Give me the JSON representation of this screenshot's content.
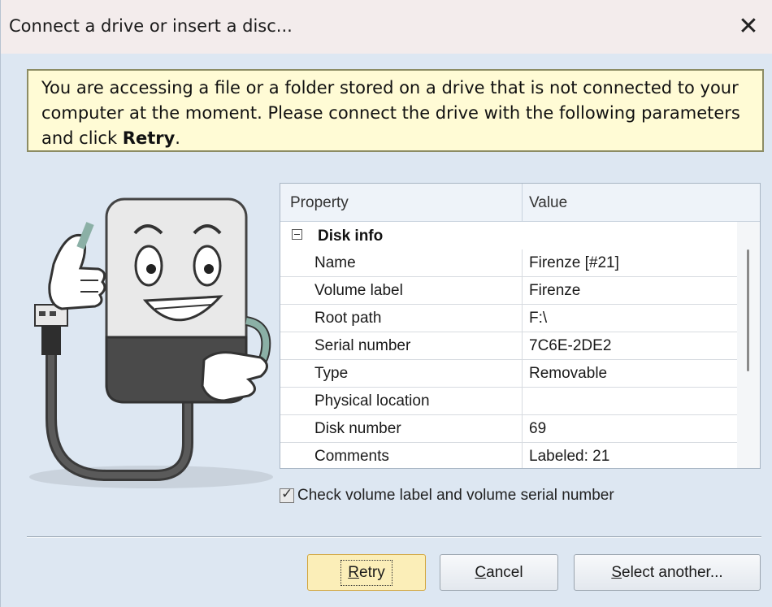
{
  "window": {
    "title": "Connect a drive or insert a disc...",
    "close_glyph": "✕"
  },
  "message": {
    "text": "You are accessing a file or a folder stored on a drive that is not connected to your computer at the moment. Please connect the drive with the following parameters and click ",
    "bold": "Retry",
    "end": "."
  },
  "grid": {
    "columns": [
      "Property",
      "Value"
    ],
    "group": {
      "label": "Disk info",
      "expander": "−"
    },
    "rows": [
      {
        "property": "Name",
        "value": "Firenze [#21]"
      },
      {
        "property": "Volume label",
        "value": "Firenze"
      },
      {
        "property": "Root path",
        "value": "F:\\"
      },
      {
        "property": "Serial number",
        "value": "7C6E-2DE2"
      },
      {
        "property": "Type",
        "value": "Removable"
      },
      {
        "property": "Physical location",
        "value": ""
      },
      {
        "property": "Disk number",
        "value": "69"
      },
      {
        "property": "Comments",
        "value": "Labeled: 21"
      }
    ]
  },
  "checkbox": {
    "label": "Check volume label and volume serial number",
    "checked": true
  },
  "buttons": {
    "retry": {
      "first": "R",
      "rest": "etry"
    },
    "cancel": {
      "first": "C",
      "rest": "ancel"
    },
    "select": {
      "first": "S",
      "rest": "elect another..."
    }
  },
  "icons": [
    "close-icon",
    "usb-drive-mascot-illustration",
    "collapse-icon",
    "checkmark-icon"
  ],
  "colors": {
    "message_bg": "#fffbd5",
    "window_bg": "#dde7f2",
    "primary_button": "#fbeeb8"
  }
}
